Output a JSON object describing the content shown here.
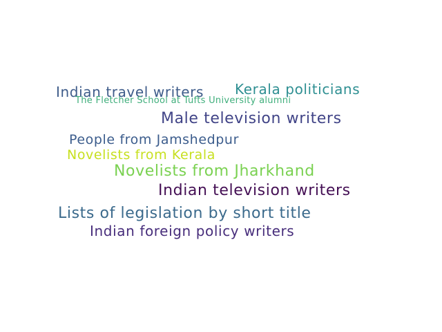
{
  "words": [
    {
      "text": "Indian travel writers",
      "color": "#3e5c8a"
    },
    {
      "text": "Kerala politicians",
      "color": "#2e8f92"
    },
    {
      "text": "The Fletcher School at Tufts University alumni",
      "color": "#3fae7b"
    },
    {
      "text": "Male television writers",
      "color": "#414487"
    },
    {
      "text": "People from Jamshedpur",
      "color": "#3b5c8c"
    },
    {
      "text": "Novelists from Kerala",
      "color": "#c7e020"
    },
    {
      "text": "Novelists from Jharkhand",
      "color": "#7ad151"
    },
    {
      "text": "Indian television writers",
      "color": "#440f54"
    },
    {
      "text": "Lists of legislation by short title",
      "color": "#3b6a8c"
    },
    {
      "text": "Indian foreign policy writers",
      "color": "#472d7b"
    }
  ]
}
